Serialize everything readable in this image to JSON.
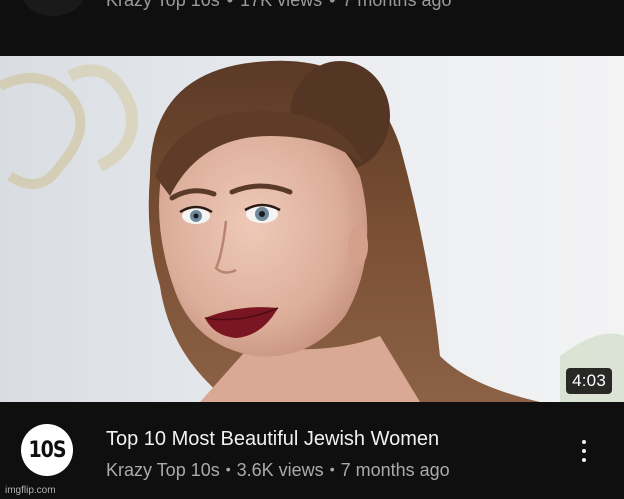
{
  "previous_video": {
    "meta_partial": "Krazy Top 10s",
    "views_partial": "17K views",
    "age_partial": "7 months ago"
  },
  "video": {
    "duration": "4:03",
    "title": "Top 10 Most Beautiful Jewish Women",
    "channel": "Krazy Top 10s",
    "views": "3.6K views",
    "age": "7 months ago",
    "separator": "•",
    "channel_avatar_text": "10S"
  },
  "watermark": "imgflip.com",
  "colors": {
    "background": "#0f0f0f",
    "primary_text": "#f1f1f1",
    "secondary_text": "#aaaaaa",
    "duration_badge": "#000000"
  },
  "icons": {
    "more": "more-vert-icon"
  }
}
